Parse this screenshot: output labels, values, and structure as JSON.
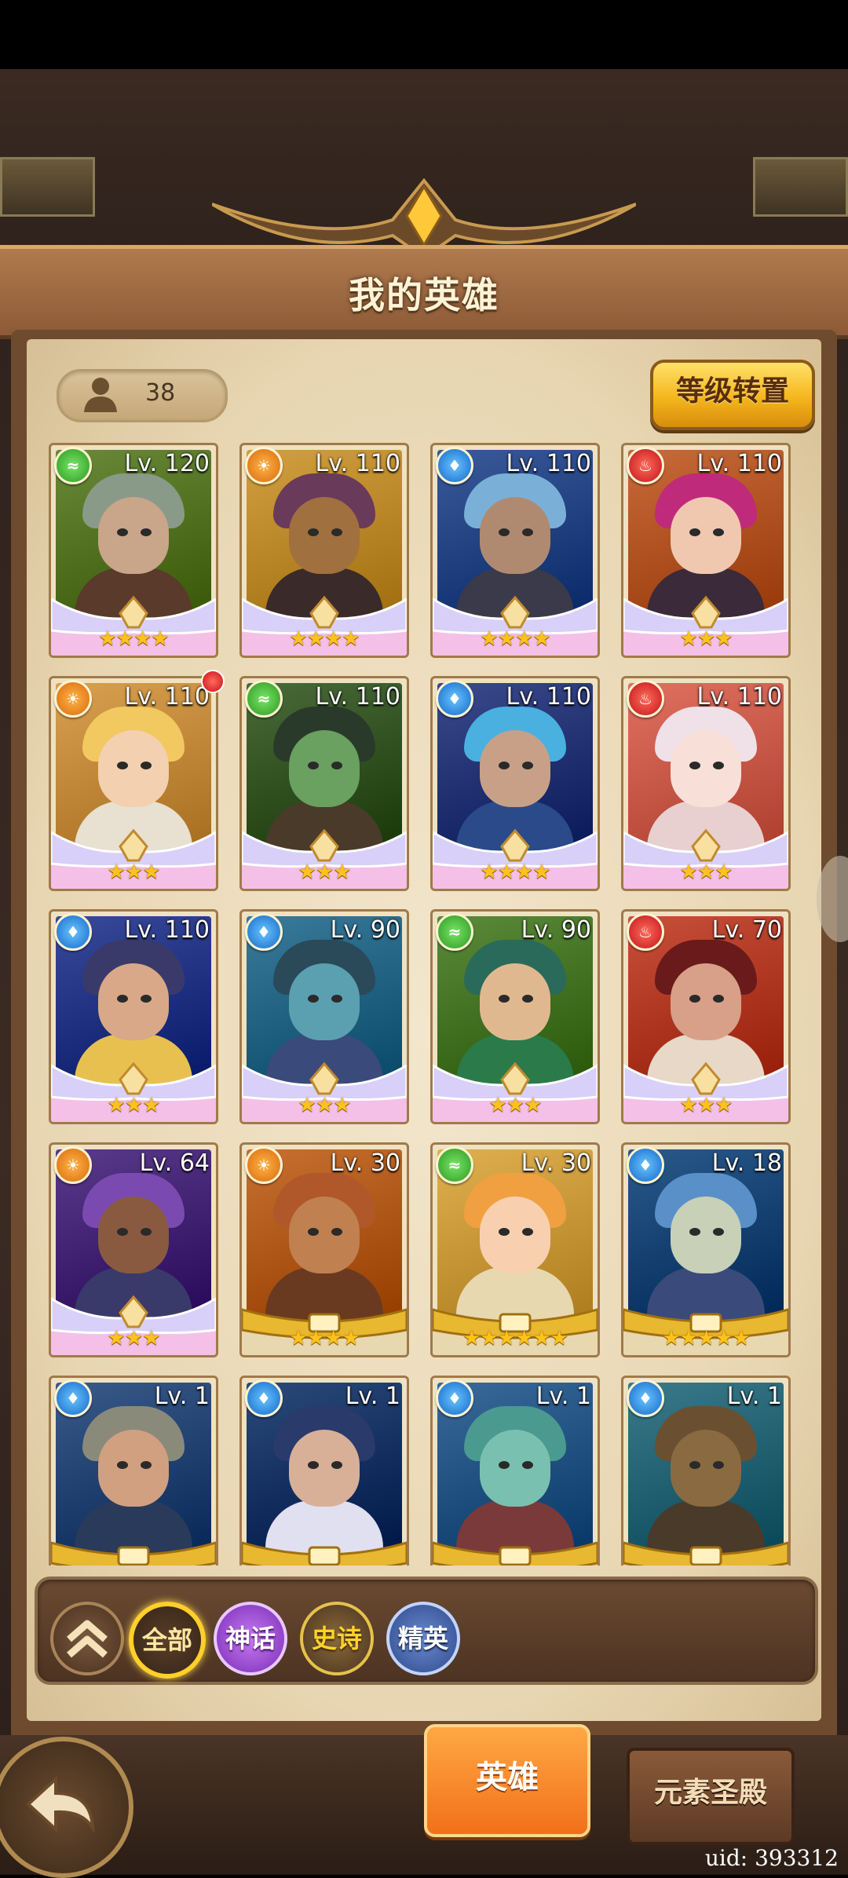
{
  "header": {
    "title": "我的英雄"
  },
  "hero_count": "38",
  "level_reset_label": "等级转置",
  "colors": {
    "wind": "#2a9a1e",
    "fire": "#c0141a",
    "water": "#1468c8",
    "light": "#d86a0a",
    "star": "#ffc21a",
    "active_tab": "#f2701a"
  },
  "heroes": [
    {
      "level": "Lv. 120",
      "element": "wind",
      "stars": "★★★★",
      "red_dot": false
    },
    {
      "level": "Lv. 110",
      "element": "light",
      "stars": "★★★★",
      "red_dot": false
    },
    {
      "level": "Lv. 110",
      "element": "water",
      "stars": "★★★★",
      "red_dot": false
    },
    {
      "level": "Lv. 110",
      "element": "fire",
      "stars": "★★★",
      "red_dot": false
    },
    {
      "level": "Lv. 110",
      "element": "light",
      "stars": "★★★",
      "red_dot": true
    },
    {
      "level": "Lv. 110",
      "element": "wind",
      "stars": "★★★",
      "red_dot": false
    },
    {
      "level": "Lv. 110",
      "element": "water",
      "stars": "★★★★",
      "red_dot": false
    },
    {
      "level": "Lv. 110",
      "element": "fire",
      "stars": "★★★",
      "red_dot": false
    },
    {
      "level": "Lv. 110",
      "element": "water",
      "stars": "★★★",
      "red_dot": false
    },
    {
      "level": "Lv. 90",
      "element": "water",
      "stars": "★★★",
      "red_dot": false
    },
    {
      "level": "Lv. 90",
      "element": "wind",
      "stars": "★★★",
      "red_dot": false
    },
    {
      "level": "Lv. 70",
      "element": "fire",
      "stars": "★★★",
      "red_dot": false
    },
    {
      "level": "Lv. 64",
      "element": "light",
      "stars": "★★★",
      "red_dot": false
    },
    {
      "level": "Lv. 30",
      "element": "light",
      "stars": "★★★★",
      "red_dot": false
    },
    {
      "level": "Lv. 30",
      "element": "wind",
      "stars": "★★★★★★",
      "red_dot": false
    },
    {
      "level": "Lv. 18",
      "element": "water",
      "stars": "★★★★★",
      "red_dot": false
    },
    {
      "level": "Lv. 1",
      "element": "water",
      "stars": "",
      "red_dot": false
    },
    {
      "level": "Lv. 1",
      "element": "water",
      "stars": "",
      "red_dot": false
    },
    {
      "level": "Lv. 1",
      "element": "water",
      "stars": "",
      "red_dot": false
    },
    {
      "level": "Lv. 1",
      "element": "water",
      "stars": "",
      "red_dot": false
    }
  ],
  "filters": {
    "collapse_icon": "double-chevron-up-icon",
    "all": "全部",
    "myth": "神话",
    "epic": "史诗",
    "elite": "精英"
  },
  "tabs": {
    "hero": "英雄",
    "temple": "元素圣殿"
  },
  "uid": "uid: 393312"
}
